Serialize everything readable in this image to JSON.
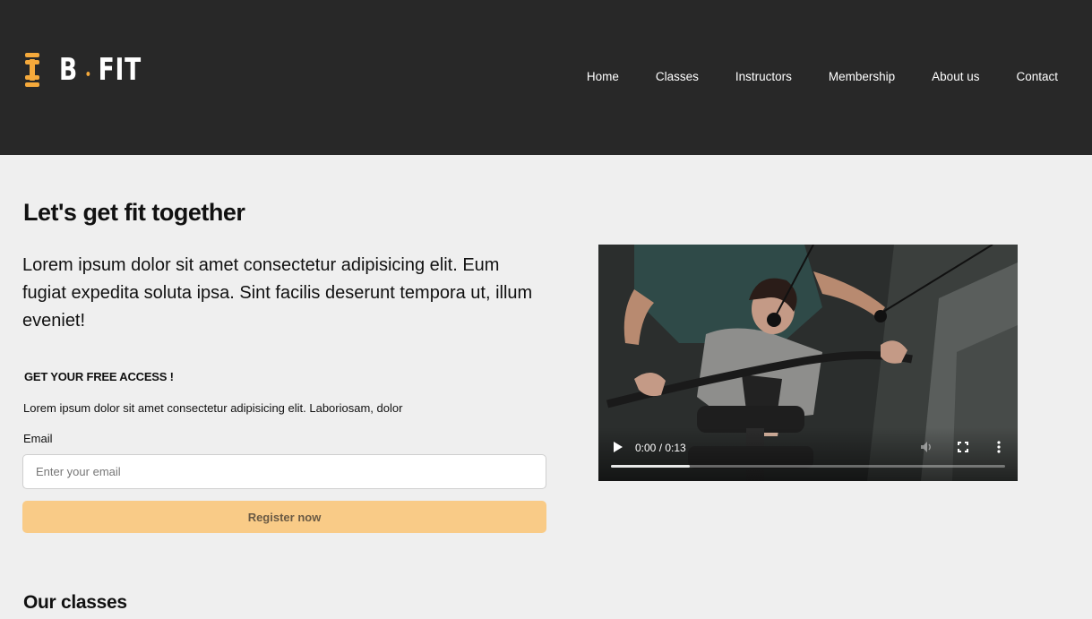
{
  "brand": {
    "name_left": "B",
    "name_right": "FIT",
    "accent_color": "#f5a93b",
    "logo_icon": "dumbbell-icon"
  },
  "nav": {
    "items": [
      {
        "label": "Home"
      },
      {
        "label": "Classes"
      },
      {
        "label": "Instructors"
      },
      {
        "label": "Membership"
      },
      {
        "label": "About us"
      },
      {
        "label": "Contact"
      }
    ]
  },
  "hero": {
    "title": "Let's get fit together",
    "lead": "Lorem ipsum dolor sit amet consectetur adipisicing elit. Eum fugiat expedita soluta ipsa. Sint facilis deserunt tempora ut, illum eveniet!"
  },
  "signup": {
    "title": "GET YOUR FREE ACCESS !",
    "text": "Lorem ipsum dolor sit amet consectetur adipisicing elit. Laboriosam, dolor",
    "email_label": "Email",
    "email_value": "",
    "email_placeholder": "Enter your email",
    "button_label": "Register now",
    "button_color": "#f9cb87"
  },
  "video": {
    "time": "0:00 / 0:13",
    "progress": 0.2,
    "icons": [
      "play-icon",
      "volume-icon",
      "fullscreen-icon",
      "more-options-icon"
    ]
  },
  "classes": {
    "title": "Our classes"
  }
}
